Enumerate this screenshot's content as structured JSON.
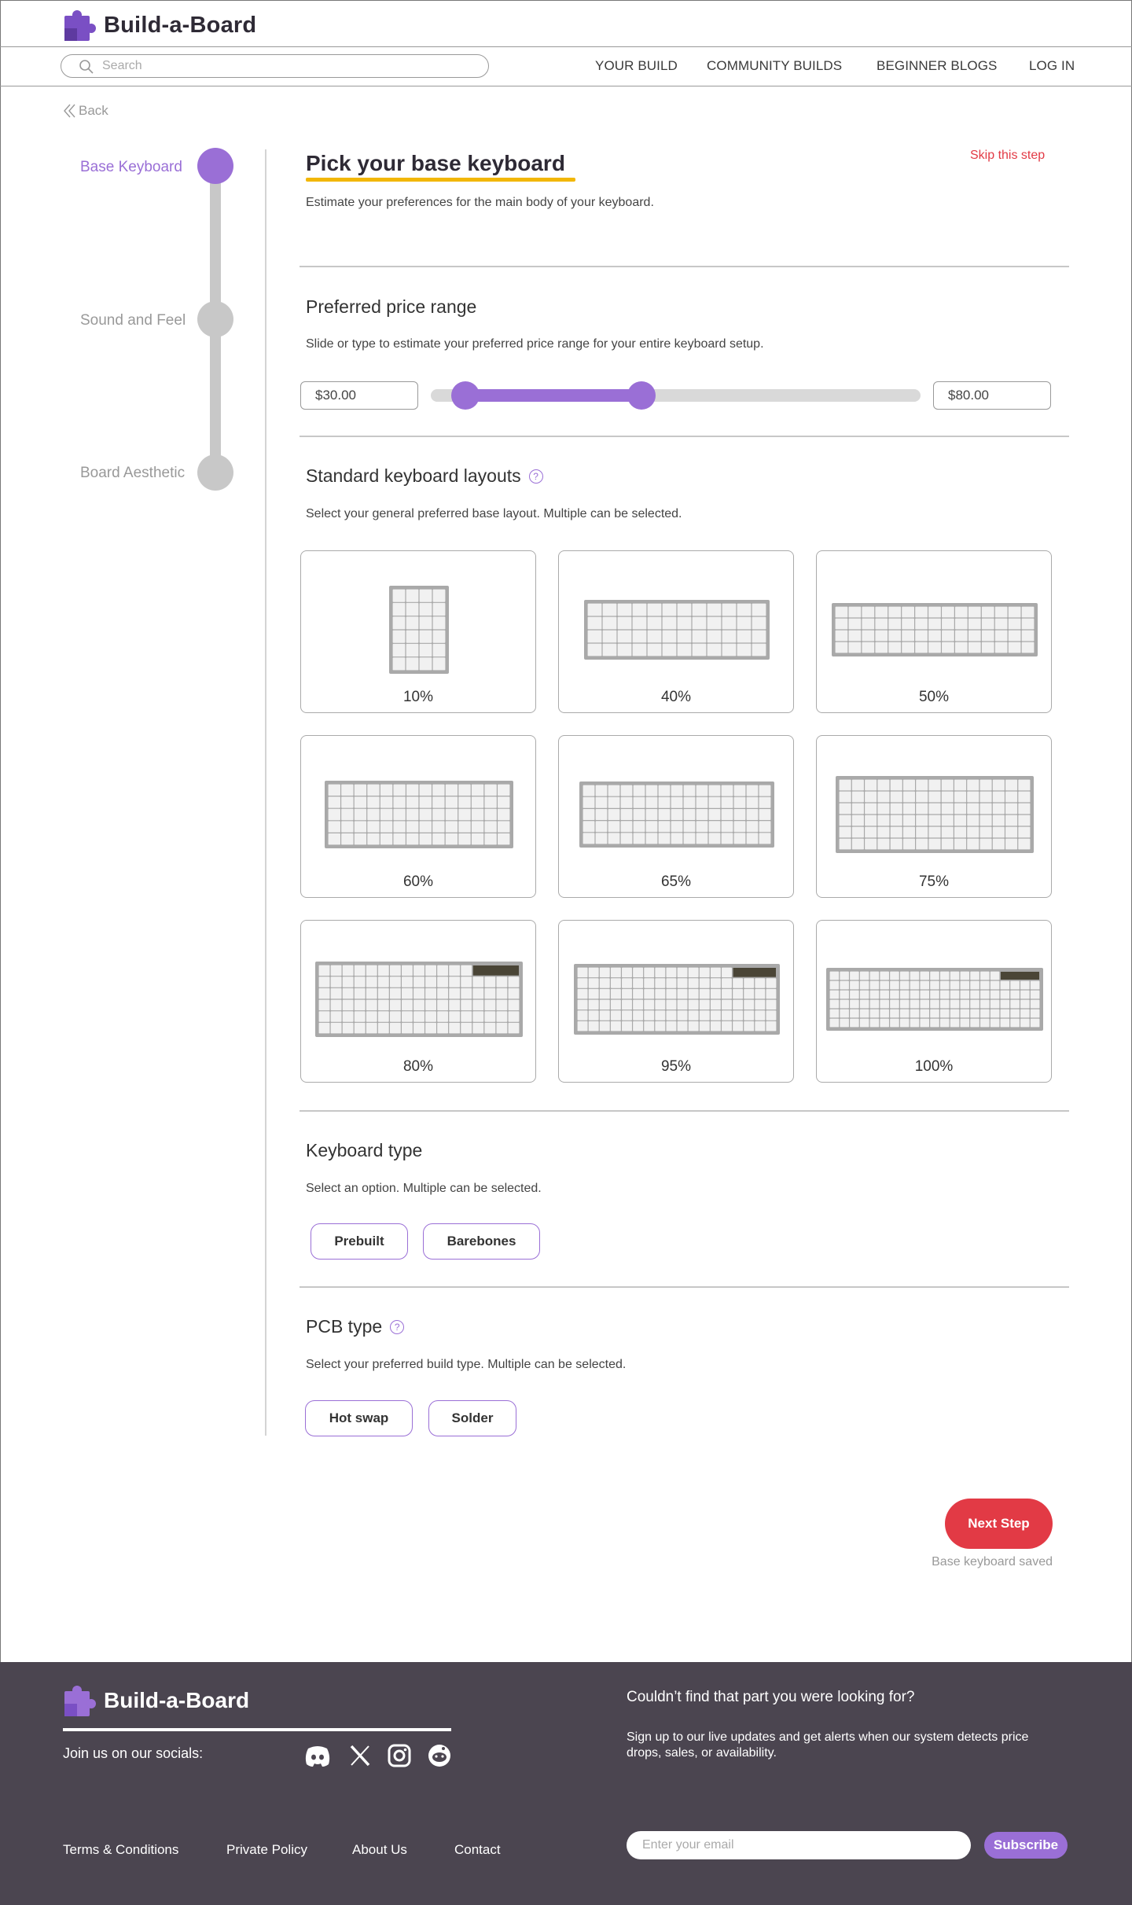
{
  "header": {
    "brand": "Build-a-Board",
    "search": {
      "placeholder": "Search",
      "value": ""
    },
    "nav": [
      "YOUR BUILD",
      "COMMUNITY BUILDS",
      "BEGINNER BLOGS",
      "LOG IN"
    ]
  },
  "back_label": "Back",
  "steps": [
    {
      "label": "Base Keyboard",
      "active": true
    },
    {
      "label": "Sound and Feel",
      "active": false
    },
    {
      "label": "Board Aesthetic",
      "active": false
    }
  ],
  "main": {
    "title": "Pick your base keyboard",
    "subtitle": "Estimate your preferences for the main body of your keyboard.",
    "skip_label": "Skip this step",
    "price": {
      "title": "Preferred price range",
      "description": "Slide or type to estimate your preferred price range for your entire keyboard setup.",
      "min_value": "$30.00",
      "max_value": "$80.00",
      "range_start_fraction": 0.07,
      "range_end_fraction": 0.43
    },
    "layouts": {
      "title": "Standard keyboard layouts",
      "description": "Select your general preferred base layout. Multiple can be selected.",
      "items": [
        "10%",
        "40%",
        "50%",
        "60%",
        "65%",
        "75%",
        "80%",
        "95%",
        "100%"
      ]
    },
    "keyboard_type": {
      "title": "Keyboard type",
      "description": "Select an option. Multiple can be selected.",
      "options": [
        "Prebuilt",
        "Barebones"
      ]
    },
    "pcb_type": {
      "title": "PCB type",
      "description": "Select your preferred build type. Multiple can be selected.",
      "options": [
        "Hot swap",
        "Solder"
      ]
    },
    "next_label": "Next Step",
    "saved_label": "Base keyboard saved"
  },
  "footer": {
    "brand": "Build-a-Board",
    "socials_label": "Join us on our socials:",
    "socials": [
      "discord-icon",
      "x-icon",
      "instagram-icon",
      "reddit-icon"
    ],
    "cta_heading": "Couldn’t find that part you were looking for?",
    "cta_text": "Sign up to our live updates and get alerts when our system detects price drops, sales, or availability.",
    "links": [
      "Terms & Conditions",
      "Private Policy",
      "About Us",
      "Contact"
    ],
    "email_placeholder": "Enter your email",
    "subscribe_label": "Subscribe"
  },
  "colors": {
    "accent": "#9a6fd6",
    "cta": "#e23a45",
    "highlight": "#f2b705",
    "footer_bg": "#4b4550"
  }
}
